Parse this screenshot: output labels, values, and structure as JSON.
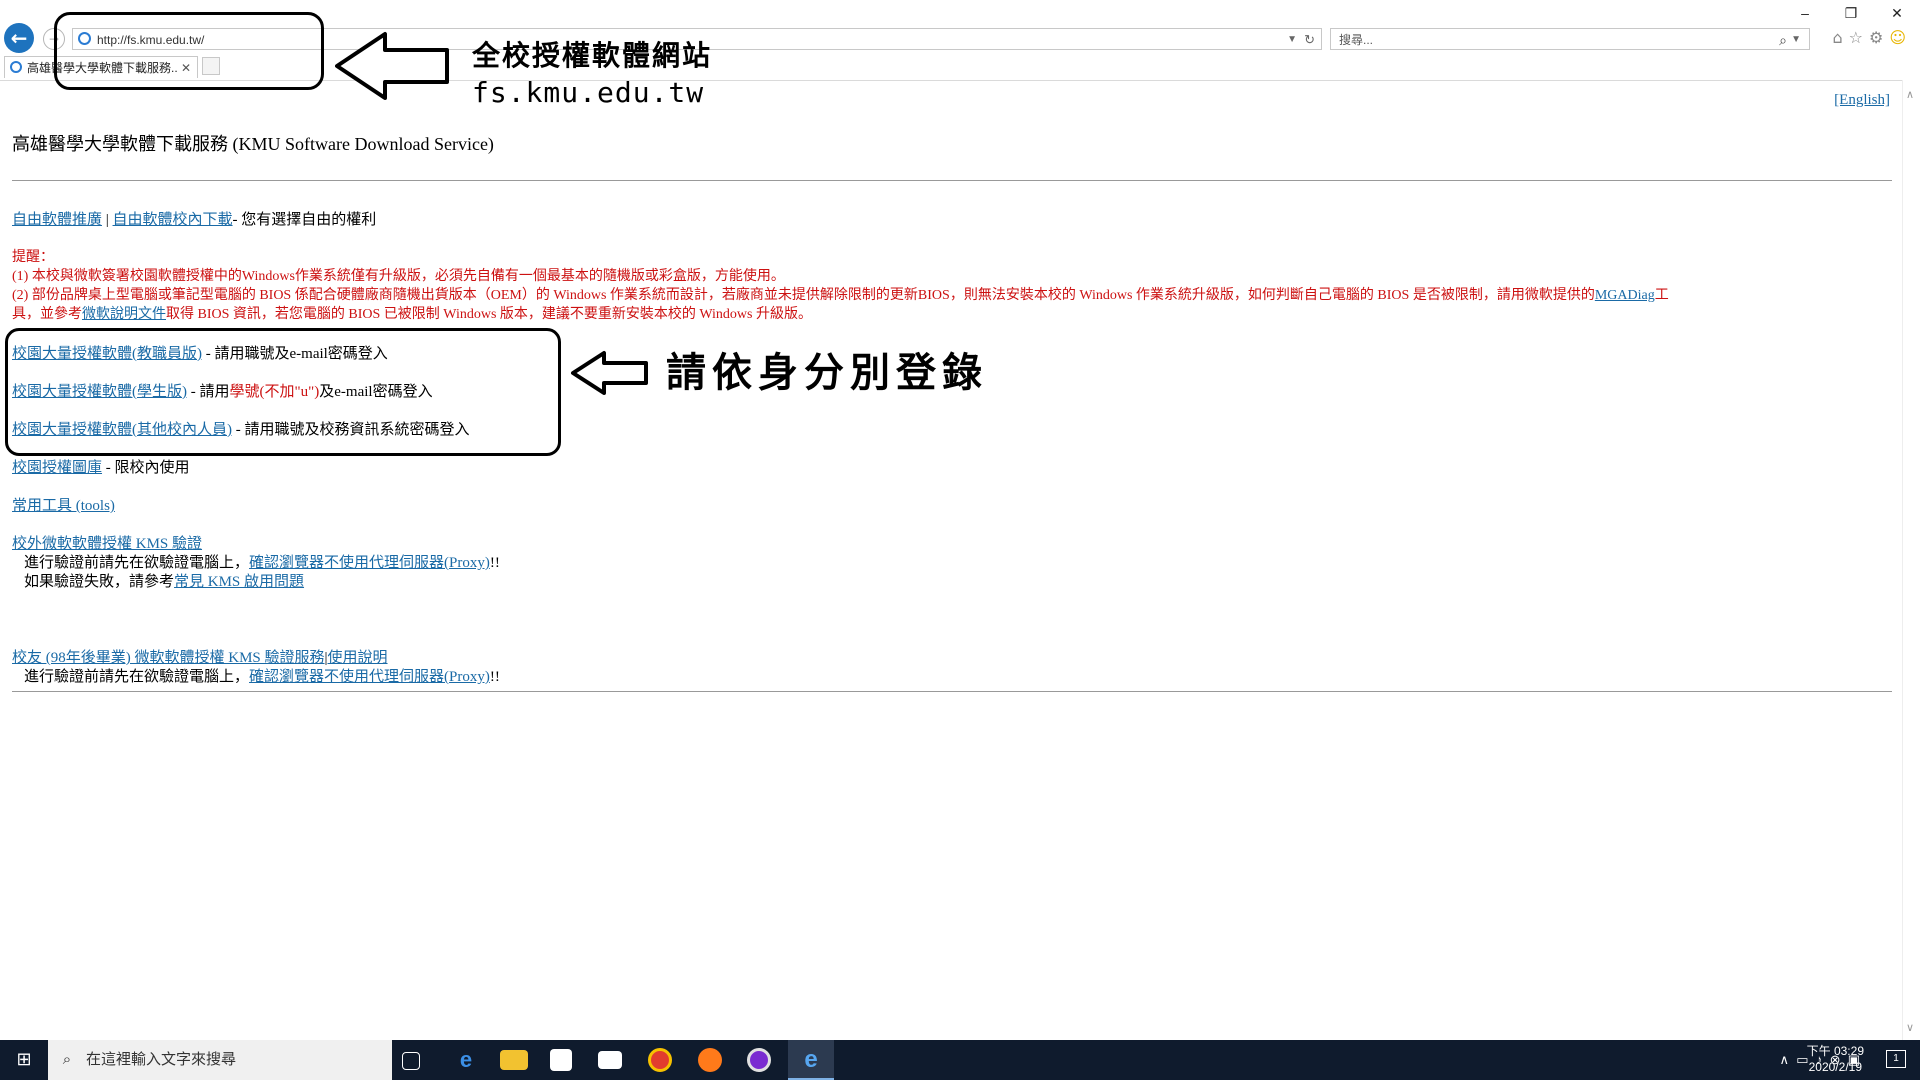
{
  "browser": {
    "url": "http://fs.kmu.edu.tw/",
    "search_placeholder": "搜尋...",
    "tab_title": "高雄醫學大學軟體下載服務..."
  },
  "annotations": {
    "top_label_line1": "全校授權軟體網站",
    "top_label_line2": "fs.kmu.edu.tw",
    "login_label": "請依身分別登錄"
  },
  "page": {
    "english_link": "[English]",
    "title": "高雄醫學大學軟體下載服務 (KMU Software Download Service)",
    "free_sw": {
      "link1": "自由軟體推廣",
      "sep": "|",
      "link2": "自由軟體校內下載",
      "text": "- 您有選擇自由的權利"
    },
    "notice": {
      "heading": "提醒：",
      "item1": "(1) 本校與微軟簽署校園軟體授權中的Windows作業系統僅有升級版，必須先自備有一個最基本的隨機版或彩盒版，方能使用。",
      "item2_part1": "(2) 部份品牌桌上型電腦或筆記型電腦的 BIOS 係配合硬體廠商隨機出貨版本（OEM）的 Windows 作業系統而設計，若廠商並未提供解除限制的更新BIOS，則無法安裝本校的 Windows 作業系統升級版，如何判斷自己電腦的 BIOS 是否被限制，請用微軟提供的",
      "item2_link1": "MGADiag",
      "item2_part2": "工",
      "item2_line2_part1": "具，並參考",
      "item2_link2": "微軟說明文件",
      "item2_line2_part2": "取得 BIOS 資訊，若您電腦的 BIOS 已被限制 Windows 版本，建議不要重新安裝本校的 Windows 升級版。"
    },
    "license_links": [
      {
        "link": "校園大量授權軟體(教職員版)",
        "text_a": " - 請用職號及e-mail密碼登入",
        "text_red": "",
        "text_b": ""
      },
      {
        "link": "校園大量授權軟體(學生版)",
        "text_a": " - 請用",
        "text_red": "學號(不加\"u\")",
        "text_b": "及e-mail密碼登入"
      },
      {
        "link": "校園大量授權軟體(其他校內人員)",
        "text_a": " - 請用職號及校務資訊系統密碼登入",
        "text_red": "",
        "text_b": ""
      }
    ],
    "gallery": {
      "link": "校園授權圖庫",
      "text": " - 限校內使用"
    },
    "tools": {
      "link": "常用工具 (tools)"
    },
    "kms": {
      "link": "校外微軟軟體授權 KMS 驗證",
      "line1_text": "進行驗證前請先在欲驗證電腦上，",
      "line1_link": "確認瀏覽器不使用代理伺服器(Proxy)",
      "line1_end": "!!",
      "line2_text": "如果驗證失敗，請參考",
      "line2_link": "常見 KMS 啟用問題"
    },
    "alumni": {
      "link1": "校友 (98年後畢業) 微軟軟體授權 KMS 驗證服務",
      "sep": "|",
      "link2": "使用說明",
      "line1_text": "進行驗證前請先在欲驗證電腦上，",
      "line1_link": "確認瀏覽器不使用代理伺服器(Proxy)",
      "line1_end": "!!"
    }
  },
  "taskbar": {
    "search_placeholder": "在這裡輸入文字來搜尋",
    "time": "下午 03:29",
    "date": "2020/2/19",
    "notif_count": "1"
  }
}
